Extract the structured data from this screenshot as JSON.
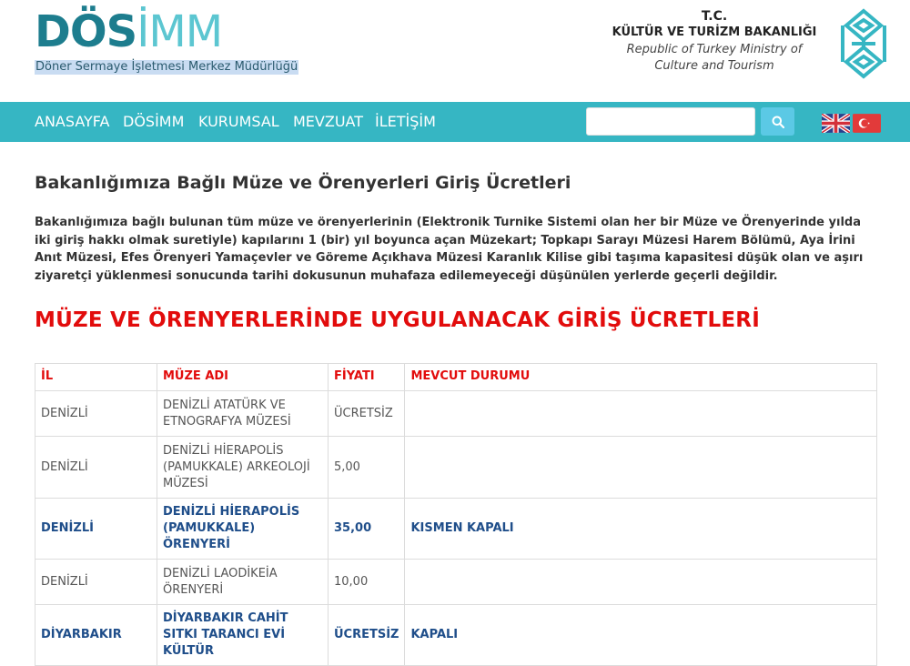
{
  "header": {
    "logo": {
      "part1": "DÖS",
      "part2": "İM",
      "part3": "M"
    },
    "logo_subtitle": "Döner Sermaye İşletmesi Merkez Müdürlüğü",
    "ministry": {
      "tc": "T.C.",
      "name": "KÜLTÜR VE TURİZM BAKANLIĞI",
      "en_line1": "Republic of Turkey Ministry of",
      "en_line2": "Culture and Tourism"
    }
  },
  "nav": {
    "items": [
      "ANASAYFA",
      "DÖSİMM",
      "KURUMSAL",
      "MEVZUAT",
      "İLETİŞİM"
    ],
    "search_placeholder": ""
  },
  "colors": {
    "nav_bg": "#36b6c3",
    "red_heading": "#e20c0c",
    "highlight_row": "#1f4e8a"
  },
  "main": {
    "title": "Bakanlığımıza Bağlı Müze ve Örenyerleri Giriş Ücretleri",
    "intro": "Bakanlığımıza bağlı bulunan tüm müze ve örenyerlerinin (Elektronik Turnike Sistemi olan her bir Müze ve Örenyerinde yılda iki giriş hakkı olmak suretiyle) kapılarını 1 (bir) yıl boyunca açan Müzekart; Topkapı Sarayı Müzesi Harem Bölümü, Aya İrini Anıt Müzesi, Efes Örenyeri Yamaçevler ve Göreme Açıkhava Müzesi Karanlık Kilise gibi taşıma kapasitesi düşük olan ve aşırı ziyaretçi yüklenmesi sonucunda tarihi dokusunun muhafaza edilemeyeceği düşünülen yerlerde geçerli değildir.",
    "fees_heading": "MÜZE VE ÖRENYERLERİNDE UYGULANACAK GİRİŞ ÜCRETLERİ",
    "table": {
      "headers": [
        "İL",
        "MÜZE ADI",
        "FİYATI",
        "MEVCUT DURUMU"
      ],
      "rows": [
        [
          "DENİZLİ",
          "DENİZLİ ATATÜRK VE ETNOGRAFYA MÜZESİ",
          "ÜCRETSİZ",
          ""
        ],
        [
          "DENİZLİ",
          "DENİZLİ HİERAPOLİS (PAMUKKALE) ARKEOLOJİ MÜZESİ",
          "5,00",
          ""
        ],
        [
          "DENİZLİ",
          "DENİZLİ HİERAPOLİS (PAMUKKALE) ÖRENYERİ",
          "35,00",
          "KISMEN KAPALI"
        ],
        [
          "DENİZLİ",
          "DENİZLİ LAODİKEİA ÖRENYERİ",
          "10,00",
          ""
        ],
        [
          "DİYARBAKIR",
          "DİYARBAKIR CAHİT SITKI TARANCI EVİ KÜLTÜR",
          "ÜCRETSİZ",
          "KAPALI"
        ]
      ]
    }
  }
}
